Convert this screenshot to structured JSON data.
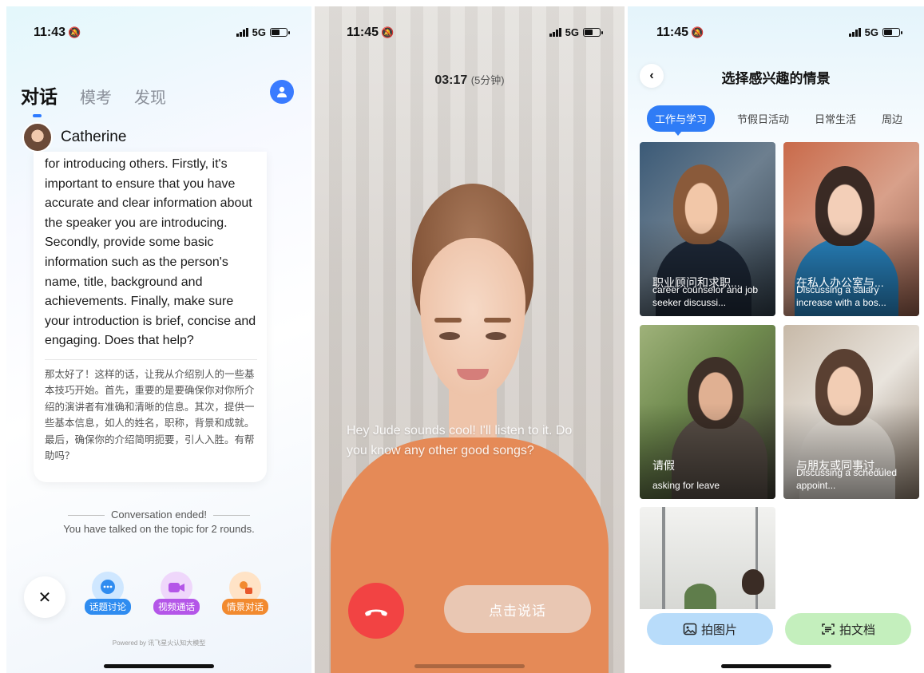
{
  "panel1": {
    "status": {
      "time": "11:43",
      "network": "5G"
    },
    "tabs": [
      "对话",
      "模考",
      "发现"
    ],
    "speaker": "Catherine",
    "message_en": "for introducing others. Firstly, it's important to ensure that you have accurate and clear information about the speaker you are introducing. Secondly, provide some basic information such as the person's name, title, background and achievements. Finally, make sure your introduction is brief, concise and engaging. Does that help?",
    "message_zh": "那太好了！这样的话，让我从介绍别人的一些基本技巧开始。首先，重要的是要确保你对你所介绍的演讲者有准确和清晰的信息。其次，提供一些基本信息，如人的姓名，职称，背景和成就。最后，确保你的介绍简明扼要，引人入胜。有帮助吗？",
    "ended_title": "Conversation ended!",
    "ended_detail": "You have talked on the topic for 2 rounds.",
    "actions": [
      {
        "label": "话题讨论",
        "color": "#2f8cf0"
      },
      {
        "label": "视频通话",
        "color": "#b456e8"
      },
      {
        "label": "情景对话",
        "color": "#f28a2f"
      }
    ],
    "powered_by": "Powered by  讯飞星火认知大模型"
  },
  "panel2": {
    "status": {
      "time": "11:45",
      "network": "5G"
    },
    "call_time": "03:17",
    "call_limit": "(5分钟)",
    "subtitle": "Hey Jude sounds cool! I'll listen to it. Do you know any other good songs?",
    "talk_button": "点击说话"
  },
  "panel3": {
    "status": {
      "time": "11:45",
      "network": "5G"
    },
    "title": "选择感兴趣的情景",
    "categories": [
      "工作与学习",
      "节假日活动",
      "日常生活",
      "周边"
    ],
    "cards": [
      {
        "title": "职业顾问和求职...",
        "subtitle": "career counselor and job seeker discussi..."
      },
      {
        "title": "在私人办公室与...",
        "subtitle": "Discussing a salary increase with a bos..."
      },
      {
        "title": "请假",
        "subtitle": "asking for leave"
      },
      {
        "title": "与朋友或同事讨...",
        "subtitle": "Discussing a scheduled appoint..."
      }
    ],
    "photo_button": "拍图片",
    "doc_button": "拍文档"
  }
}
